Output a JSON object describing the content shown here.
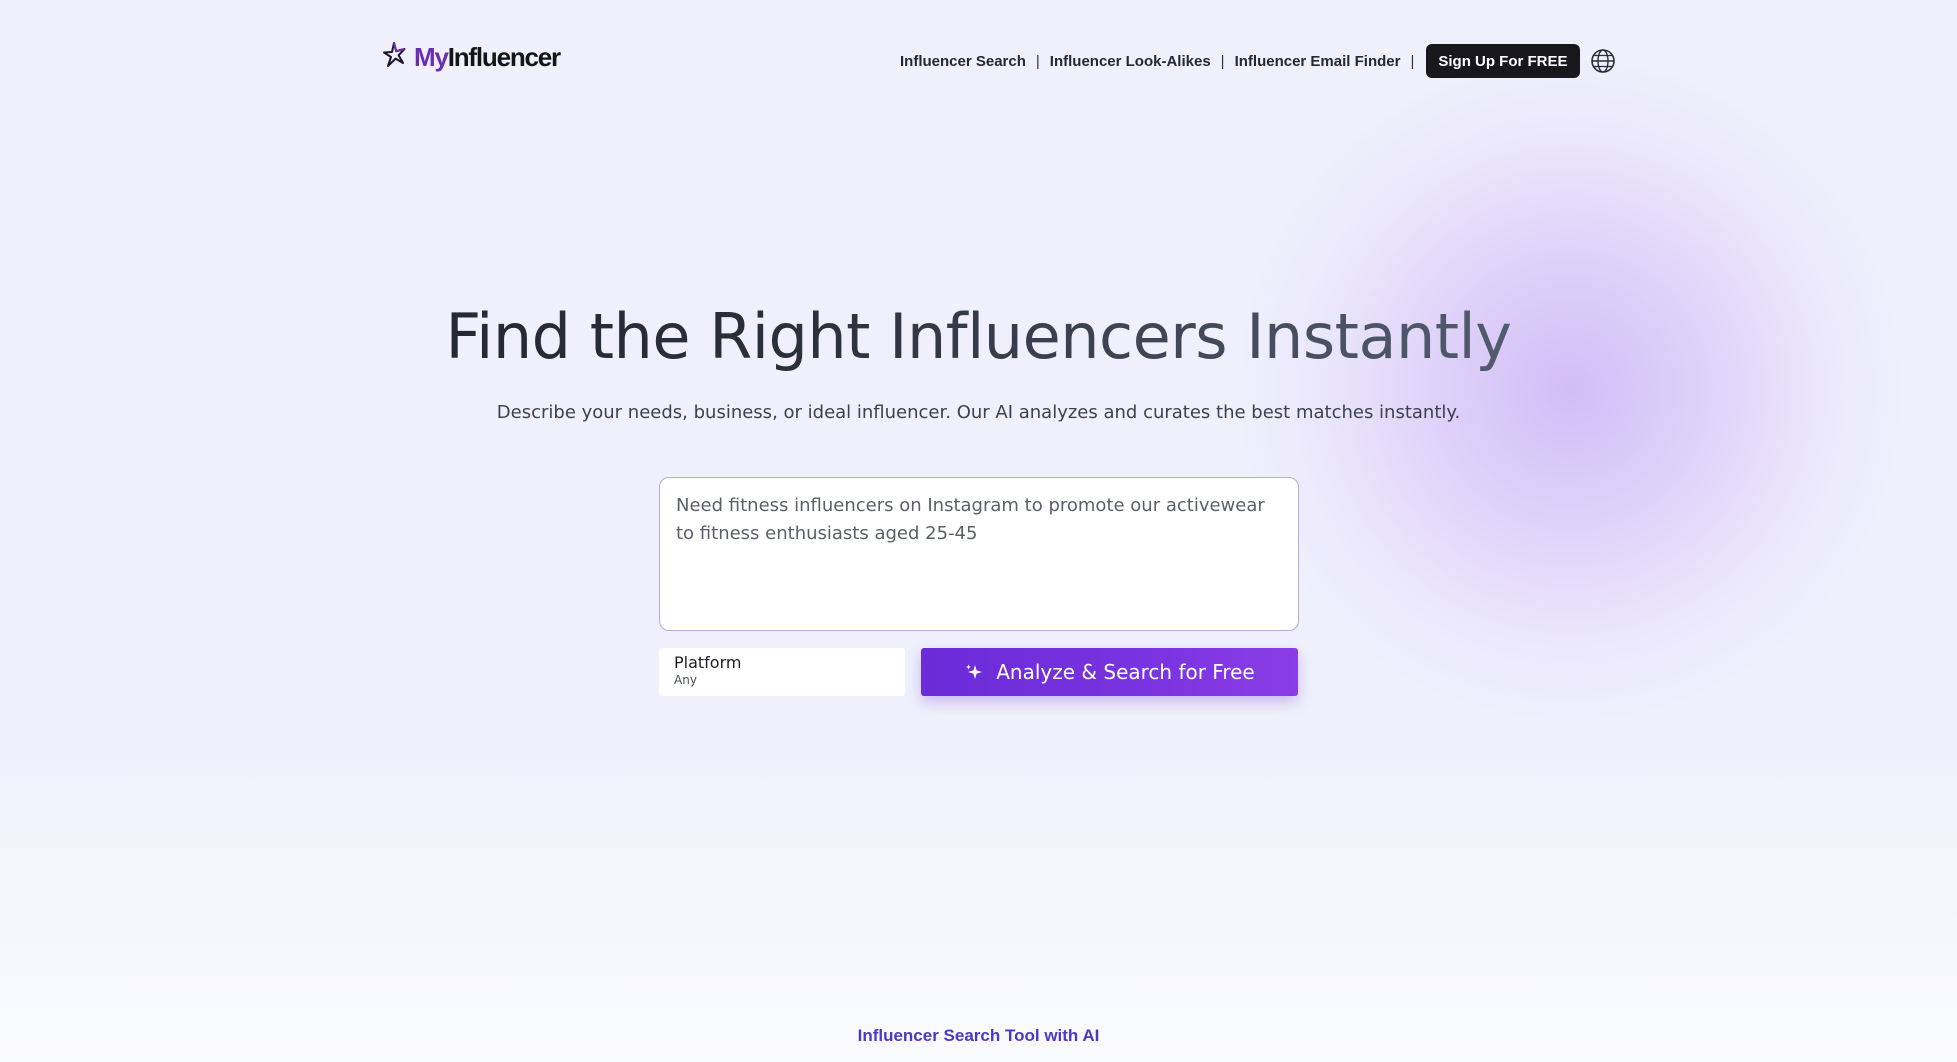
{
  "header": {
    "logo": {
      "prefix": "My",
      "suffix": "Influencer"
    },
    "nav": [
      {
        "label": "Influencer Search"
      },
      {
        "label": "Influencer Look-Alikes"
      },
      {
        "label": "Influencer Email Finder"
      }
    ],
    "separator": "|",
    "signup_label": "Sign Up For FREE",
    "language_icon": "globe-icon"
  },
  "hero": {
    "title": "Find the Right Influencers Instantly",
    "subtitle": "Describe your needs, business, or ideal influencer. Our AI analyzes and curates the best matches instantly."
  },
  "search": {
    "query_value": "Need fitness influencers on Instagram to promote our activewear to fitness enthusiasts aged 25-45",
    "platform_label": "Platform",
    "platform_value": "Any",
    "analyze_label": "Analyze & Search for Free",
    "analyze_icon": "sparkle-icon"
  },
  "footer": {
    "tagline": "Influencer Search Tool with AI"
  },
  "colors": {
    "brand_purple": "#6a2fb0",
    "button_purple": "#7330dc",
    "signup_dark": "#17171c",
    "tagline_blue": "#4a39c6"
  }
}
